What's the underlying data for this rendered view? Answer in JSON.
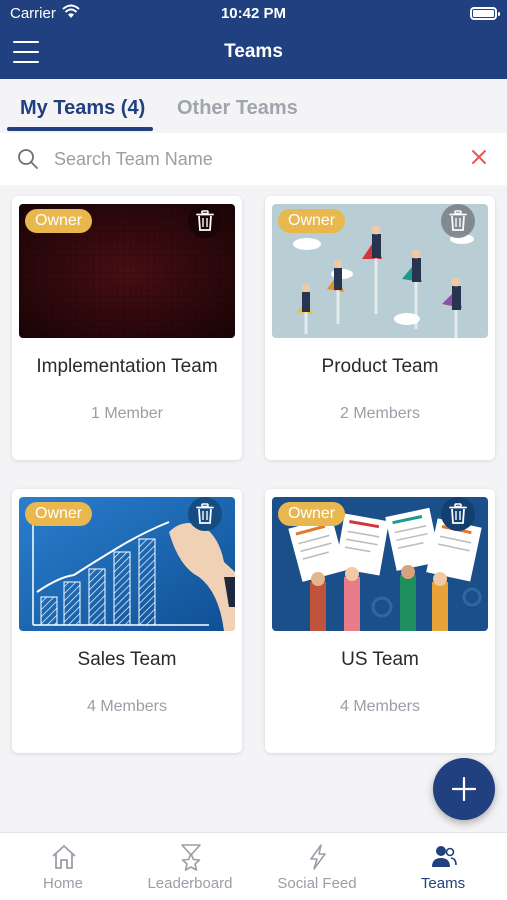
{
  "status_bar": {
    "carrier": "Carrier",
    "time": "10:42 PM"
  },
  "header": {
    "title": "Teams"
  },
  "tabs": [
    {
      "label": "My Teams (4)",
      "active": true
    },
    {
      "label": "Other Teams",
      "active": false
    }
  ],
  "search": {
    "placeholder": "Search Team Name",
    "value": ""
  },
  "teams": [
    {
      "name": "Implementation Team",
      "members": "1 Member",
      "badge": "Owner",
      "image": "dark-red-texture"
    },
    {
      "name": "Product Team",
      "members": "2 Members",
      "badge": "Owner",
      "image": "flying-superhero-businessmen"
    },
    {
      "name": "Sales Team",
      "members": "4 Members",
      "badge": "Owner",
      "image": "sales-bar-chart-drawing"
    },
    {
      "name": "US Team",
      "members": "4 Members",
      "badge": "Owner",
      "image": "hands-holding-documents"
    }
  ],
  "fab": {
    "icon": "plus-icon"
  },
  "bottom_nav": [
    {
      "label": "Home",
      "icon": "home-icon",
      "active": false
    },
    {
      "label": "Leaderboard",
      "icon": "trophy-star-icon",
      "active": false
    },
    {
      "label": "Social Feed",
      "icon": "lightning-icon",
      "active": false
    },
    {
      "label": "Teams",
      "icon": "people-icon",
      "active": true
    }
  ],
  "colors": {
    "primary": "#21407f",
    "badge": "#e8b84f",
    "muted": "#9a9ea6",
    "clear": "#e55a5a"
  }
}
